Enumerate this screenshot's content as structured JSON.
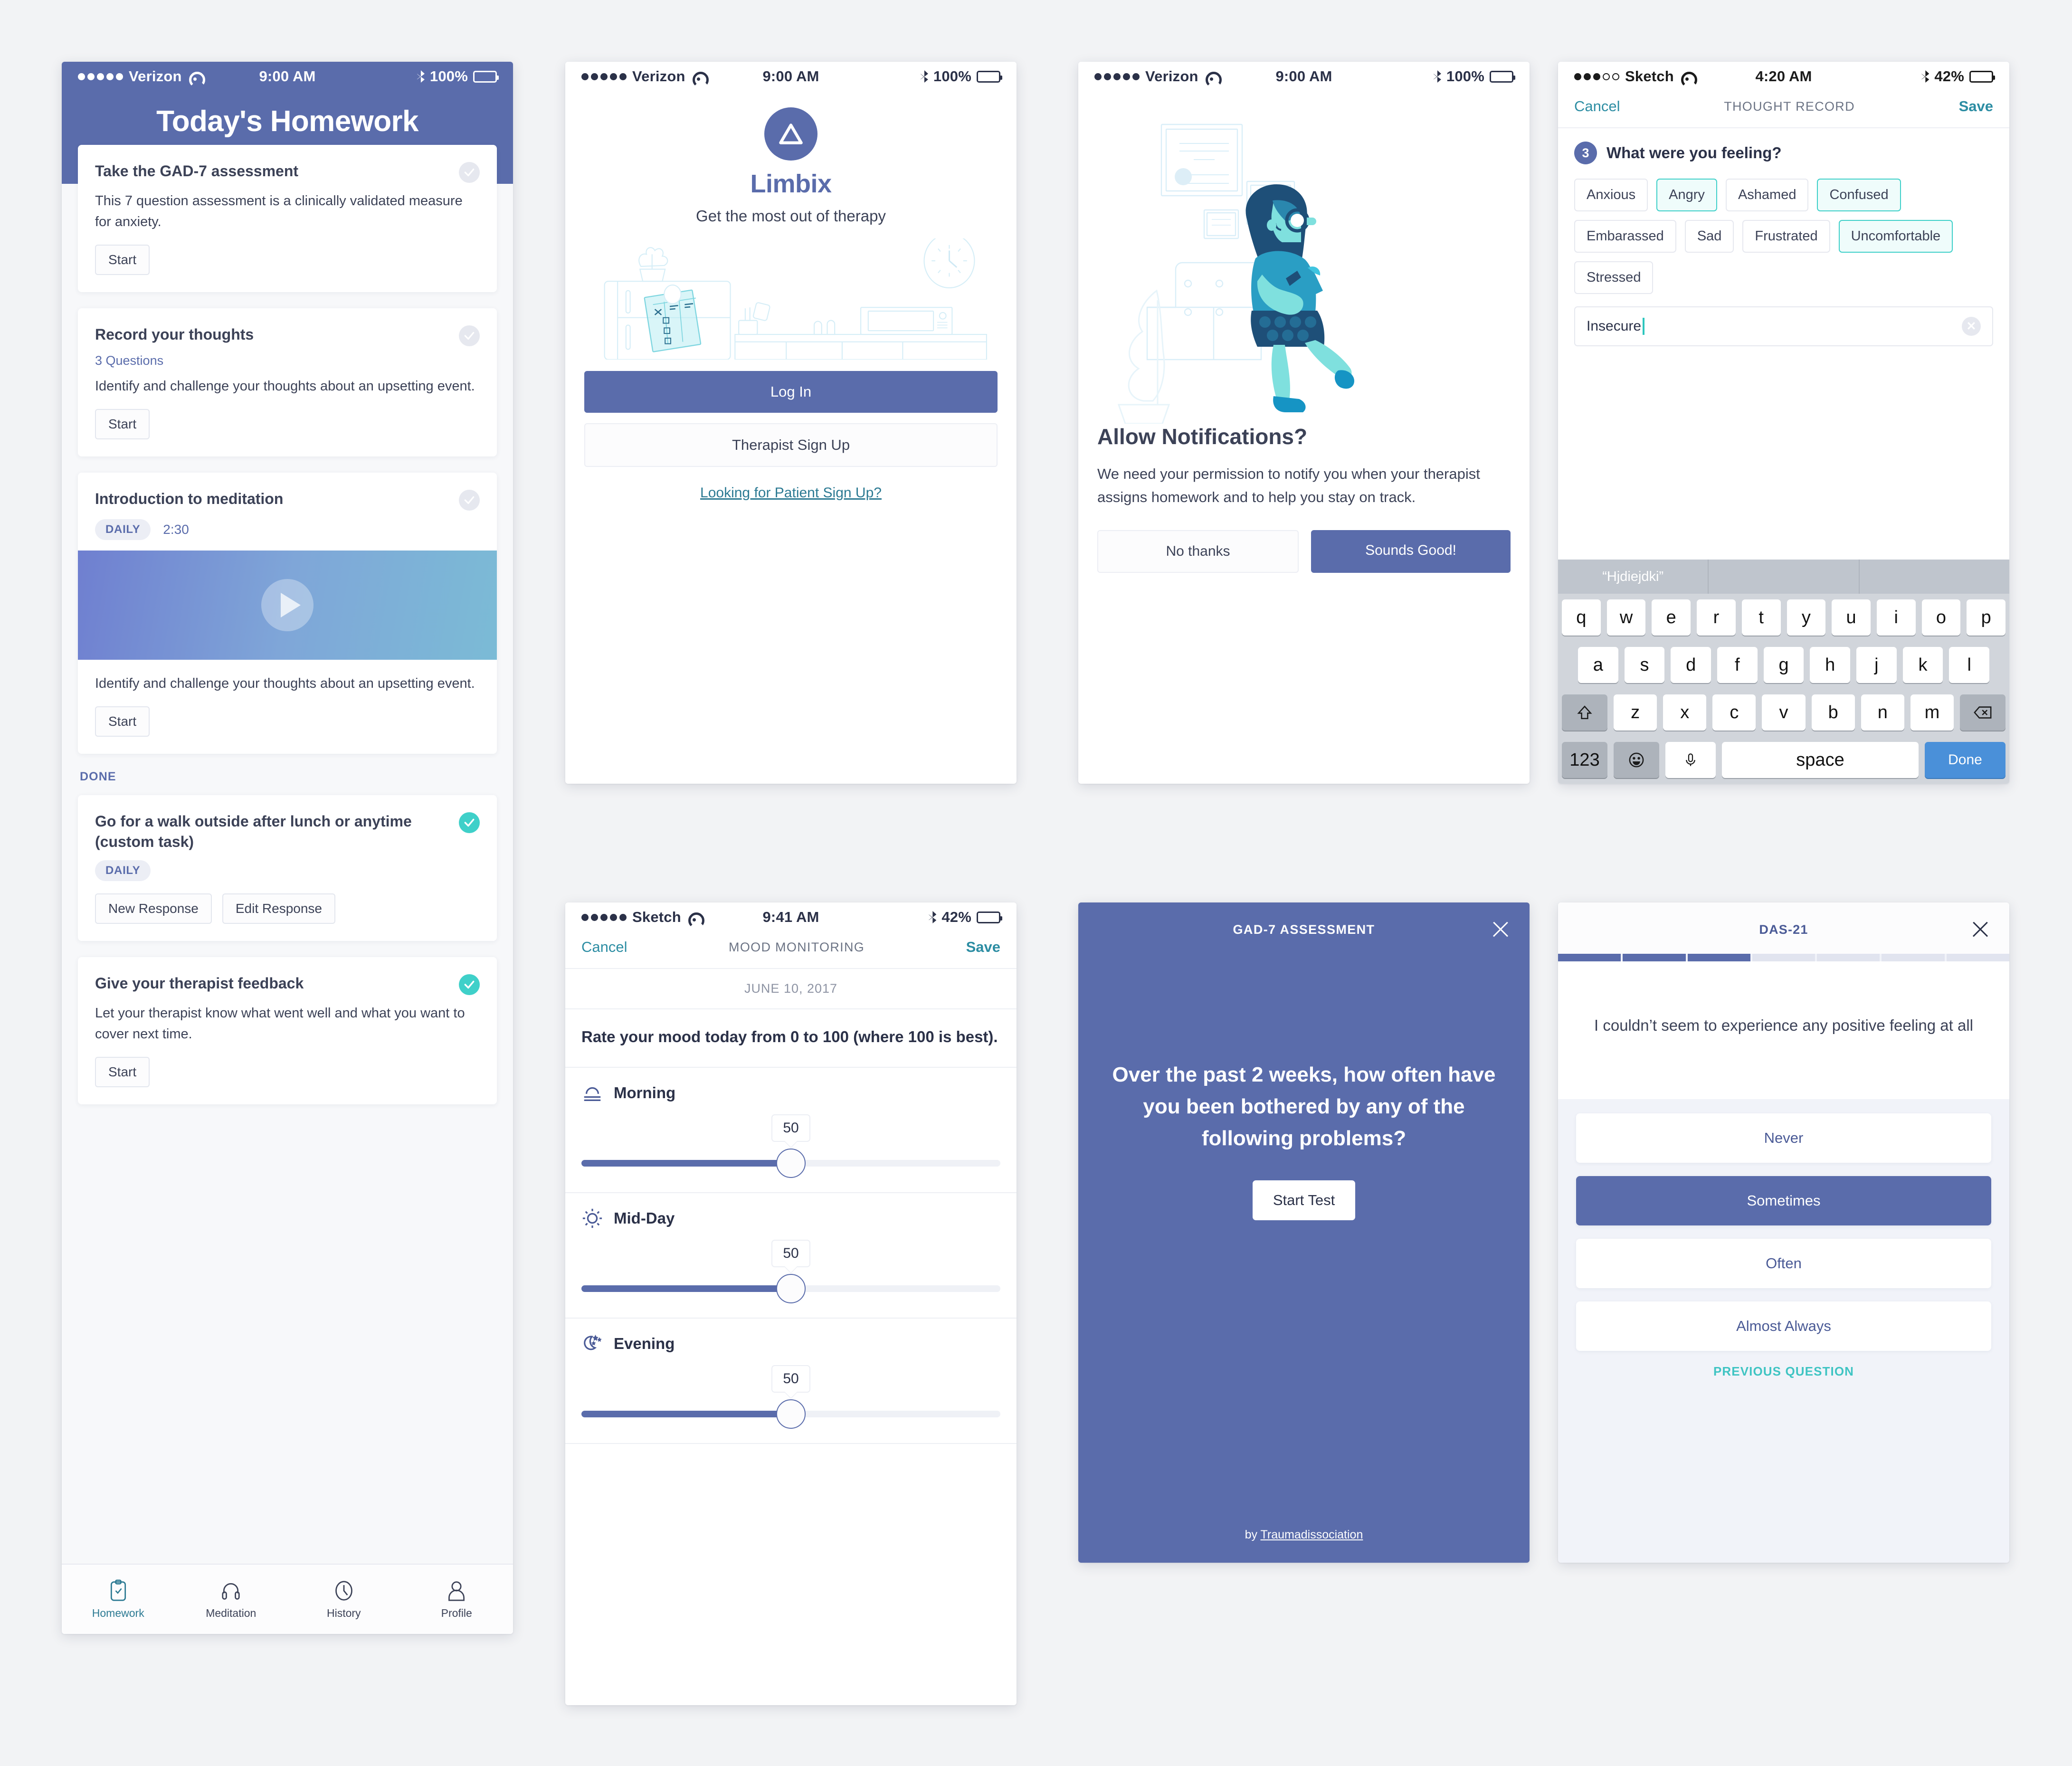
{
  "screens": {
    "homework": {
      "status": {
        "carrier": "Verizon",
        "time": "9:00 AM",
        "battery": "100%"
      },
      "title": "Today's Homework",
      "tasks": [
        {
          "title": "Take the GAD-7 assessment",
          "desc": "This 7 question assessment is a clinically validated measure for anxiety.",
          "button": "Start"
        },
        {
          "title": "Record your thoughts",
          "sub": "3 Questions",
          "desc": "Identify and challenge your thoughts about an upsetting event.",
          "button": "Start"
        },
        {
          "title": "Introduction to meditation",
          "badge": "DAILY",
          "duration": "2:30",
          "desc": "Identify and challenge your thoughts about an upsetting event.",
          "button": "Start"
        }
      ],
      "done_label": "DONE",
      "done_tasks": [
        {
          "title": "Go for a walk outside after lunch or anytime (custom task)",
          "badge": "DAILY",
          "button1": "New Response",
          "button2": "Edit Response"
        },
        {
          "title": "Give your therapist feedback",
          "desc": "Let your therapist know what went well and what you want to cover next time.",
          "button": "Start"
        }
      ],
      "tabs": [
        {
          "label": "Homework",
          "icon": "clipboard-check-icon"
        },
        {
          "label": "Meditation",
          "icon": "headphones-icon"
        },
        {
          "label": "History",
          "icon": "clock-icon"
        },
        {
          "label": "Profile",
          "icon": "person-icon"
        }
      ]
    },
    "login": {
      "status": {
        "carrier": "Verizon",
        "time": "9:00 AM",
        "battery": "100%"
      },
      "brand": "Limbix",
      "tagline": "Get the most out of therapy",
      "login_button": "Log In",
      "signup_button": "Therapist Sign Up",
      "patient_link": "Looking for Patient Sign Up?"
    },
    "notifications": {
      "status": {
        "carrier": "Verizon",
        "time": "9:00 AM",
        "battery": "100%"
      },
      "title": "Allow Notifications?",
      "desc": "We need your permission to notify you when your therapist assigns homework and to help you stay on track.",
      "decline": "No thanks",
      "accept": "Sounds Good!"
    },
    "thought_record": {
      "status": {
        "carrier": "Sketch",
        "time": "4:20 AM",
        "battery": "42%"
      },
      "nav": {
        "cancel": "Cancel",
        "title": "THOUGHT RECORD",
        "save": "Save"
      },
      "question_number": "3",
      "question": "What were you feeling?",
      "chips": [
        {
          "label": "Anxious",
          "selected": false
        },
        {
          "label": "Angry",
          "selected": true
        },
        {
          "label": "Ashamed",
          "selected": false
        },
        {
          "label": "Confused",
          "selected": true
        },
        {
          "label": "Embarassed",
          "selected": false
        },
        {
          "label": "Sad",
          "selected": false
        },
        {
          "label": "Frustrated",
          "selected": false
        },
        {
          "label": "Uncomfortable",
          "selected": true
        },
        {
          "label": "Stressed",
          "selected": false
        }
      ],
      "input_value": "Insecure",
      "keyboard": {
        "prediction": "“Hjdiejdki”",
        "row1": [
          "q",
          "w",
          "e",
          "r",
          "t",
          "y",
          "u",
          "i",
          "o",
          "p"
        ],
        "row2": [
          "a",
          "s",
          "d",
          "f",
          "g",
          "h",
          "j",
          "k",
          "l"
        ],
        "row3": [
          "z",
          "x",
          "c",
          "v",
          "b",
          "n",
          "m"
        ],
        "numbers_key": "123",
        "space_key": "space",
        "done_key": "Done"
      }
    },
    "mood": {
      "status": {
        "carrier": "Sketch",
        "time": "9:41 AM",
        "battery": "42%"
      },
      "nav": {
        "cancel": "Cancel",
        "title": "MOOD MONITORING",
        "save": "Save"
      },
      "date": "JUNE 10, 2017",
      "question": "Rate your mood today from 0 to 100 (where 100 is best).",
      "periods": [
        {
          "name": "Morning",
          "value": "50",
          "icon": "sunrise-icon"
        },
        {
          "name": "Mid-Day",
          "value": "50",
          "icon": "sun-icon"
        },
        {
          "name": "Evening",
          "value": "50",
          "icon": "moon-stars-icon"
        }
      ]
    },
    "gad7": {
      "title": "GAD-7 ASSESSMENT",
      "question": "Over the past 2 weeks, how often have you been bothered by any of the following problems?",
      "start_button": "Start Test",
      "footer_prefix": "by ",
      "footer_link": "Traumadissociation"
    },
    "das21": {
      "title": "DAS-21",
      "progress_total": 7,
      "progress_filled": 3,
      "question": "I couldn’t seem to experience any positive feeling at all",
      "options": [
        {
          "label": "Never",
          "selected": false
        },
        {
          "label": "Sometimes",
          "selected": true
        },
        {
          "label": "Often",
          "selected": false
        },
        {
          "label": "Almost Always",
          "selected": false
        }
      ],
      "previous": "PREVIOUS QUESTION"
    }
  },
  "colors": {
    "brand_blue": "#5a6cab",
    "teal": "#3fd0c9",
    "link_teal": "#2c8da3",
    "text_dark": "#3c4257",
    "bg": "#f2f3f5"
  }
}
